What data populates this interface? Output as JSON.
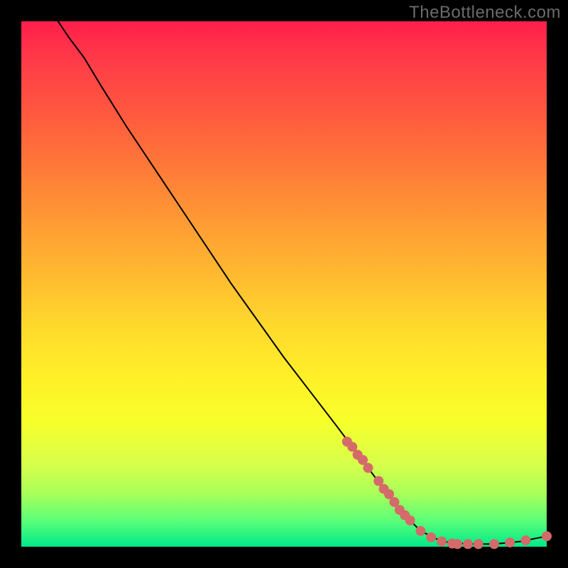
{
  "watermark": "TheBottleneck.com",
  "chart_data": {
    "type": "line",
    "title": "",
    "xlabel": "",
    "ylabel": "",
    "xlim": [
      0,
      100
    ],
    "ylim": [
      0,
      100
    ],
    "grid": false,
    "curve": [
      {
        "x": 7,
        "y": 100
      },
      {
        "x": 9,
        "y": 97
      },
      {
        "x": 12,
        "y": 93
      },
      {
        "x": 15,
        "y": 88
      },
      {
        "x": 20,
        "y": 80
      },
      {
        "x": 30,
        "y": 65
      },
      {
        "x": 40,
        "y": 50
      },
      {
        "x": 50,
        "y": 36
      },
      {
        "x": 60,
        "y": 23
      },
      {
        "x": 66,
        "y": 15
      },
      {
        "x": 72,
        "y": 7
      },
      {
        "x": 76,
        "y": 3
      },
      {
        "x": 80,
        "y": 1
      },
      {
        "x": 85,
        "y": 0.5
      },
      {
        "x": 90,
        "y": 0.5
      },
      {
        "x": 95,
        "y": 1
      },
      {
        "x": 100,
        "y": 2
      }
    ],
    "markers": [
      {
        "x": 62,
        "y": 20
      },
      {
        "x": 63,
        "y": 19
      },
      {
        "x": 64,
        "y": 17.5
      },
      {
        "x": 65,
        "y": 16.5
      },
      {
        "x": 66,
        "y": 15
      },
      {
        "x": 68,
        "y": 12.5
      },
      {
        "x": 69,
        "y": 11
      },
      {
        "x": 70,
        "y": 10
      },
      {
        "x": 71,
        "y": 8.5
      },
      {
        "x": 72,
        "y": 7
      },
      {
        "x": 73,
        "y": 6
      },
      {
        "x": 74,
        "y": 5
      },
      {
        "x": 76,
        "y": 3
      },
      {
        "x": 78,
        "y": 1.8
      },
      {
        "x": 80,
        "y": 1
      },
      {
        "x": 82,
        "y": 0.6
      },
      {
        "x": 83,
        "y": 0.5
      },
      {
        "x": 85,
        "y": 0.5
      },
      {
        "x": 87,
        "y": 0.5
      },
      {
        "x": 90,
        "y": 0.5
      },
      {
        "x": 93,
        "y": 0.8
      },
      {
        "x": 96,
        "y": 1.2
      },
      {
        "x": 100,
        "y": 2
      }
    ],
    "gradient_stops": [
      {
        "pos": 0,
        "color": "#ff1f4b"
      },
      {
        "pos": 50,
        "color": "#ffd92c"
      },
      {
        "pos": 100,
        "color": "#00e98a"
      }
    ]
  }
}
